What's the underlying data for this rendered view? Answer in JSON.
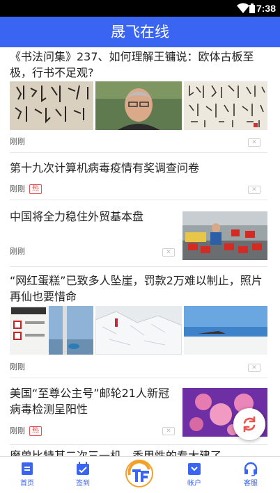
{
  "status_bar": {
    "time": "7:38"
  },
  "header": {
    "title": "晟飞在线"
  },
  "feed": {
    "items": [
      {
        "title": "《书法问集》237、如何理解王镛说：欧体古板至极，行书不足观?",
        "time": "刚刚",
        "hot": ""
      },
      {
        "title": "第十九次计算机病毒疫情有奖调查问卷",
        "time": "刚刚",
        "hot": "热"
      },
      {
        "title": "中国将全力稳住外贸基本盘",
        "time": "刚刚",
        "hot": ""
      },
      {
        "title": "“网红蛋糕”已致多人坠崖，罚款2万难以制止，照片再仙也要惜命",
        "time": "刚刚",
        "hot": ""
      },
      {
        "title": "美国“至尊公主号”邮轮21人新冠病毒检测呈阳性",
        "time": "刚刚",
        "hot": "热"
      },
      {
        "title": "魔兽比特甚二次三一机，香甲性的专大建了",
        "time": "",
        "hot": ""
      }
    ],
    "close_label": "✕"
  },
  "tabs": [
    {
      "label": "首页",
      "icon": "home-icon"
    },
    {
      "label": "签到",
      "icon": "calendar-icon"
    },
    {
      "label": "",
      "icon": "app-logo-icon"
    },
    {
      "label": "帐户",
      "icon": "account-icon"
    },
    {
      "label": "客服",
      "icon": "headset-icon"
    }
  ],
  "colors": {
    "accent": "#3a64f2",
    "hot": "#e2504f",
    "refresh": "#e8554e"
  }
}
